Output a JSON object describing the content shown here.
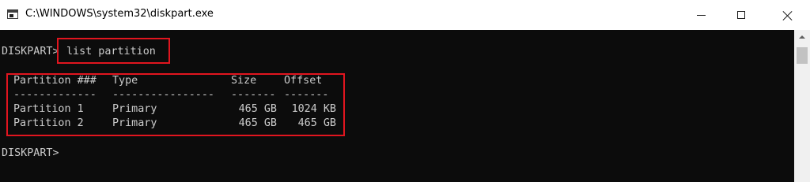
{
  "window": {
    "title": "C:\\WINDOWS\\system32\\diskpart.exe"
  },
  "console": {
    "prompt": "DISKPART>",
    "command": "list partition",
    "table": {
      "headers": [
        "Partition ###",
        "Type",
        "Size",
        "Offset"
      ],
      "separators": [
        "-------------",
        "----------------",
        "-------",
        "-------"
      ],
      "rows": [
        [
          "Partition 1",
          "Primary",
          "465 GB",
          "1024 KB"
        ],
        [
          "Partition 2",
          "Primary",
          "465 GB",
          "465 GB"
        ]
      ]
    },
    "final_prompt": "DISKPART>"
  },
  "colors": {
    "console_background": "#0c0c0c",
    "console_text": "#cccccc",
    "highlight_box": "#e1151f"
  },
  "icons": {
    "app": "console-app-icon",
    "minimize": "minimize-icon",
    "maximize": "maximize-icon",
    "close": "close-icon",
    "scroll_up": "scroll-up-arrow-icon"
  }
}
